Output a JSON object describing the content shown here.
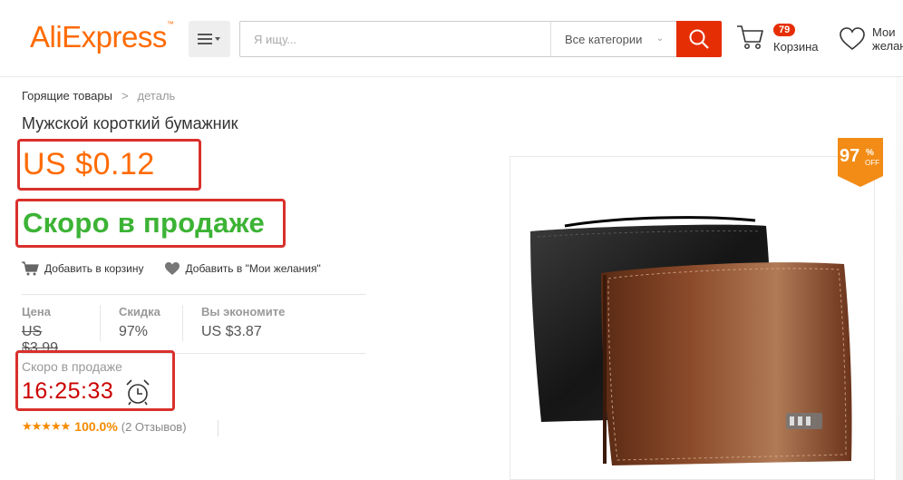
{
  "header": {
    "logo_text": "AliExpress",
    "search_placeholder": "Я ищу...",
    "category_label": "Все категории",
    "cart_count": "79",
    "cart_label": "Корзина",
    "wishlist_label_line1": "Мои",
    "wishlist_label_line2": "желан"
  },
  "breadcrumb": {
    "root": "Горящие товары",
    "separator": ">",
    "current": "деталь"
  },
  "product": {
    "title": "Мужской короткий бумажник",
    "price": "US $0.12",
    "status": "Скоро в продаже",
    "add_to_cart": "Добавить в корзину",
    "add_to_wishlist": "Добавить в \"Мои желания\"",
    "stats": {
      "price_header": "Цена",
      "price_value": "US $3.99",
      "discount_header": "Скидка",
      "discount_value": "97%",
      "save_header": "Вы экономите",
      "save_value": "US $3.87"
    },
    "timer_label": "Скоро в продаже",
    "timer": "16:25:33",
    "rating_stars": "★★★★★",
    "rating_percent": "100.0%",
    "reviews": "(2 Отзывов)",
    "badge": {
      "number": "97",
      "percent": "%",
      "off": "OFF"
    }
  },
  "colors": {
    "accent": "#e62e04",
    "price": "#ff6a00",
    "status_green": "#3cb335",
    "timer_red": "#cc0000",
    "highlight_box": "#d9302c",
    "badge": "#f28c16"
  }
}
